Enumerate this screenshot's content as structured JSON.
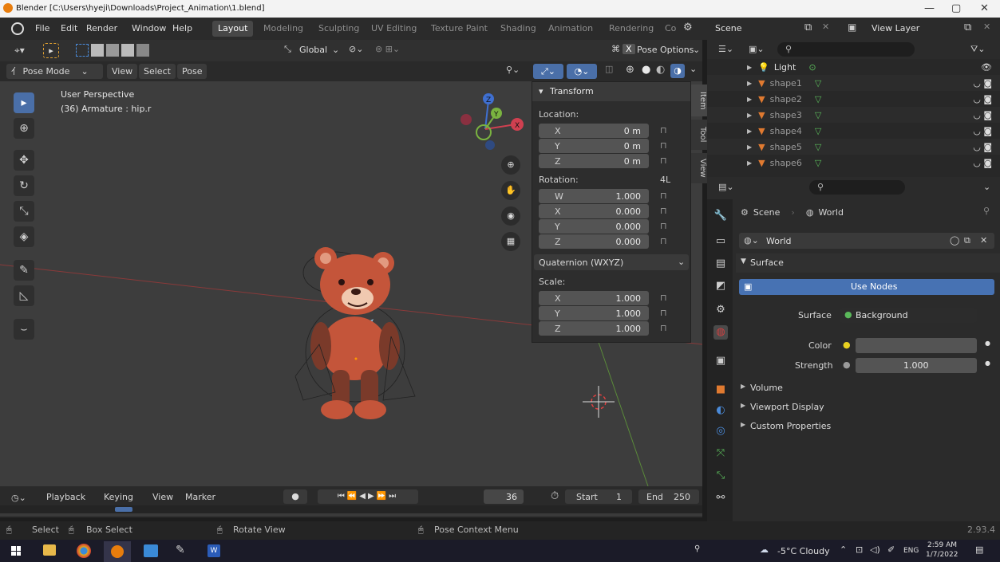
{
  "window": {
    "title": "Blender [C:\\Users\\hyeji\\Downloads\\Project_Animation\\1.blend]",
    "minimize": "—",
    "maximize": "▢",
    "close": "✕"
  },
  "menu": [
    "File",
    "Edit",
    "Render",
    "Window",
    "Help"
  ],
  "workspaces": [
    "Layout",
    "Modeling",
    "Sculpting",
    "UV Editing",
    "Texture Paint",
    "Shading",
    "Animation",
    "Rendering",
    "Co"
  ],
  "active_workspace": "Layout",
  "scene_selector": "Scene",
  "view_layer": "View Layer",
  "toolbar": {
    "orientation": "Global",
    "pose_options": "Pose Options"
  },
  "header": {
    "mode": "Pose Mode",
    "view": "View",
    "select": "Select",
    "pose": "Pose"
  },
  "viewport": {
    "line1": "User Perspective",
    "line2": "(36) Armature : hip.r"
  },
  "npanel": {
    "title": "Transform",
    "location_label": "Location:",
    "location": [
      {
        "axis": "X",
        "value": "0 m"
      },
      {
        "axis": "Y",
        "value": "0 m"
      },
      {
        "axis": "Z",
        "value": "0 m"
      }
    ],
    "rotation_label": "Rotation:",
    "rotation_mode_short": "4L",
    "rotation": [
      {
        "axis": "W",
        "value": "1.000"
      },
      {
        "axis": "X",
        "value": "0.000"
      },
      {
        "axis": "Y",
        "value": "0.000"
      },
      {
        "axis": "Z",
        "value": "0.000"
      }
    ],
    "rotation_mode": "Quaternion (WXYZ)",
    "scale_label": "Scale:",
    "scale": [
      {
        "axis": "X",
        "value": "1.000"
      },
      {
        "axis": "Y",
        "value": "1.000"
      },
      {
        "axis": "Z",
        "value": "1.000"
      }
    ],
    "tabs": [
      "Item",
      "Tool",
      "View"
    ]
  },
  "timeline": {
    "playback": "Playback",
    "keying": "Keying",
    "view": "View",
    "marker": "Marker",
    "current_frame": "36",
    "start_label": "Start",
    "start": "1",
    "end_label": "End",
    "end": "250"
  },
  "status": {
    "select": "Select",
    "box_select": "Box Select",
    "rotate_view": "Rotate View",
    "context_menu": "Pose Context Menu",
    "version": "2.93.4"
  },
  "outliner": {
    "items": [
      {
        "name": "Light"
      },
      {
        "name": "shape1"
      },
      {
        "name": "shape2"
      },
      {
        "name": "shape3"
      },
      {
        "name": "shape4"
      },
      {
        "name": "shape5"
      },
      {
        "name": "shape6"
      }
    ]
  },
  "properties": {
    "breadcrumb_scene": "Scene",
    "breadcrumb_world": "World",
    "world_name": "World",
    "surface_section": "Surface",
    "use_nodes": "Use Nodes",
    "surface_label": "Surface",
    "surface_value": "Background",
    "color_label": "Color",
    "strength_label": "Strength",
    "strength_value": "1.000",
    "volume": "Volume",
    "viewport_display": "Viewport Display",
    "custom_properties": "Custom Properties"
  },
  "taskbar": {
    "weather": "-5°C  Cloudy",
    "lang": "ENG",
    "time": "2:59 AM",
    "date": "1/7/2022"
  },
  "colors": {
    "accent": "#4a6fa8",
    "use_nodes_bg": "#4772b3",
    "bear": "#c4553a"
  }
}
